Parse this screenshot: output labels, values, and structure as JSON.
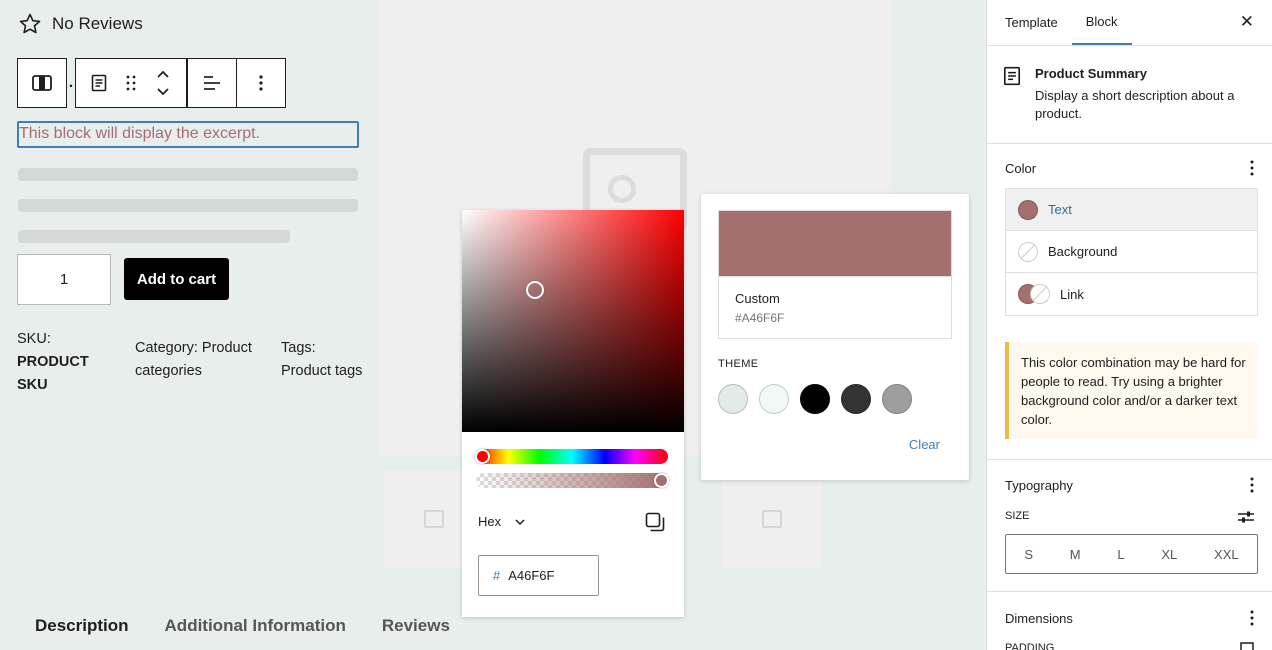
{
  "product": {
    "reviews_label": "No Reviews",
    "excerpt_placeholder": "This block will display the excerpt.",
    "quantity": "1",
    "add_to_cart": "Add to cart",
    "sku_label": "SKU:",
    "sku_value_line1": "PRODUCT",
    "sku_value_line2": "SKU",
    "category_label": "Category:",
    "category_value_1": "Product",
    "category_value_2": "categories",
    "tags_label": "Tags:",
    "tags_value": "Product tags"
  },
  "toolbar_icons": [
    "block-switcher-icon",
    "document-icon",
    "drag-handle-icon",
    "move-up-down-icon",
    "align-left-icon",
    "more-vertical-icon"
  ],
  "product_tabs": [
    {
      "label": "Description",
      "active": true
    },
    {
      "label": "Additional Information",
      "active": false
    },
    {
      "label": "Reviews",
      "active": false
    }
  ],
  "color_picker": {
    "format": "Hex",
    "hash": "#",
    "value": "A46F6F",
    "color": "#a46f6f"
  },
  "palette": {
    "custom_name": "Custom",
    "custom_code": "#A46F6F",
    "theme_label": "THEME",
    "theme_colors": [
      "#e2ebe8",
      "#f0f9f6",
      "#000000",
      "#333333",
      "#9e9e9e"
    ],
    "clear_label": "Clear"
  },
  "sidebar": {
    "tab_template": "Template",
    "tab_block": "Block",
    "close_symbol": "✕",
    "block_title": "Product Summary",
    "block_desc": "Display a short description about a product.",
    "color_title": "Color",
    "color_items": [
      {
        "label": "Text",
        "color": "#a46f6f"
      },
      {
        "label": "Background"
      },
      {
        "label": "Link",
        "color": "#a46f6f"
      }
    ],
    "warning": "This color combination may be hard for people to read. Try using a brighter background color and/or a darker text color.",
    "typography_title": "Typography",
    "size_label": "SIZE",
    "sizes": [
      "S",
      "M",
      "L",
      "XL",
      "XXL"
    ],
    "dimensions_title": "Dimensions",
    "padding_label": "PADDING"
  }
}
